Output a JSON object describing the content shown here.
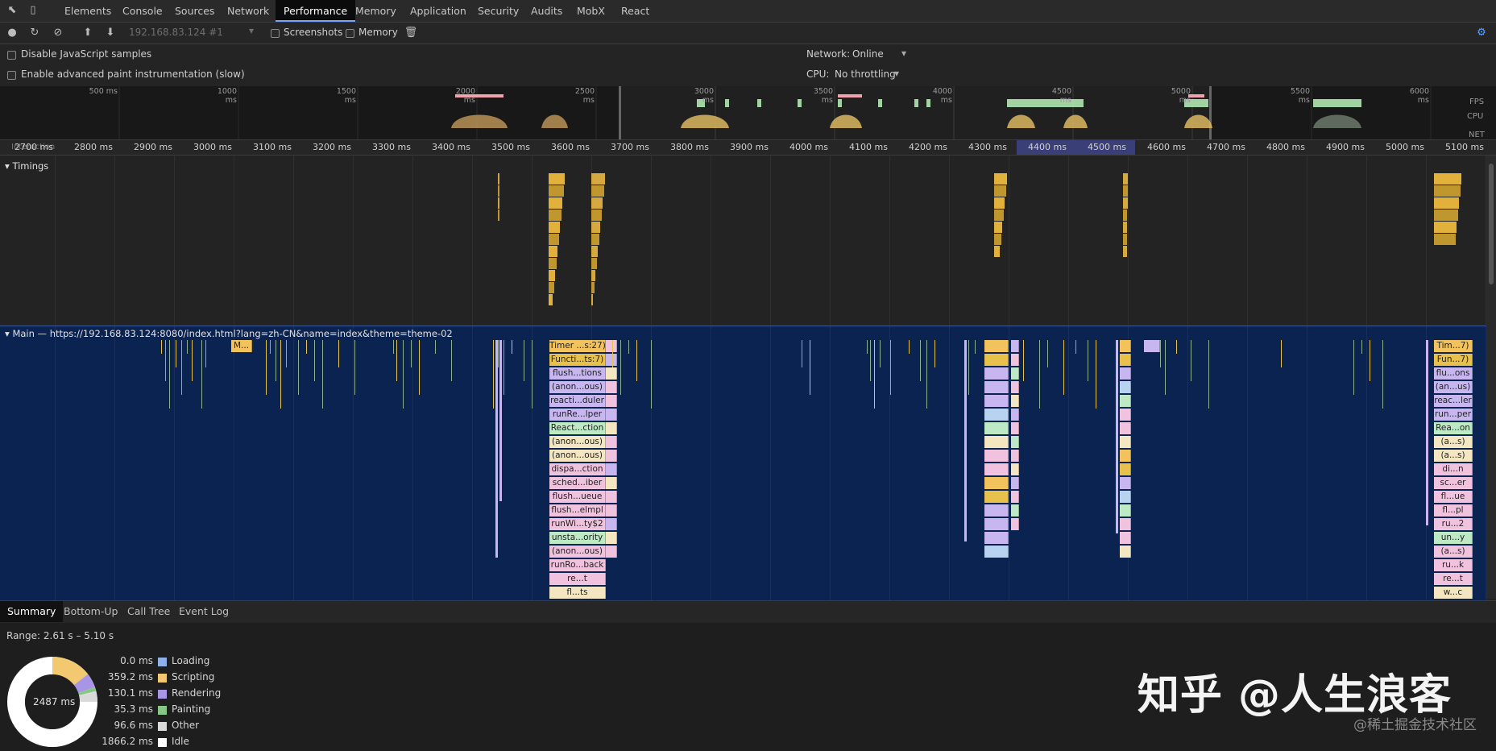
{
  "tabs": [
    "Elements",
    "Console",
    "Sources",
    "Network",
    "Performance",
    "Memory",
    "Application",
    "Security",
    "Audits",
    "MobX",
    "React"
  ],
  "active_tab": "Performance",
  "toolbar": {
    "profile_select": "192.168.83.124 #1",
    "screenshots_label": "Screenshots",
    "memory_label": "Memory"
  },
  "settings": {
    "disable_js_samples": "Disable JavaScript samples",
    "advanced_paint": "Enable advanced paint instrumentation (slow)",
    "network_label": "Network:",
    "network_value": "Online",
    "cpu_label": "CPU:",
    "cpu_value": "No throttling"
  },
  "overview": {
    "ticks": [
      "500 ms",
      "1000 ms",
      "1500 ms",
      "2000 ms",
      "2500 ms",
      "3000 ms",
      "3500 ms",
      "4000 ms",
      "4500 ms",
      "5000 ms",
      "5500 ms",
      "6000 ms"
    ],
    "labels": {
      "fps": "FPS",
      "cpu": "CPU",
      "net": "NET"
    }
  },
  "ruler": {
    "ticks": [
      "2700 ms",
      "2800 ms",
      "2900 ms",
      "3000 ms",
      "3100 ms",
      "3200 ms",
      "3300 ms",
      "3400 ms",
      "3500 ms",
      "3600 ms",
      "3700 ms",
      "3800 ms",
      "3900 ms",
      "4000 ms",
      "4100 ms",
      "4200 ms",
      "4300 ms",
      "4400 ms",
      "4500 ms",
      "4600 ms",
      "4700 ms",
      "4800 ms",
      "4900 ms",
      "5000 ms",
      "5100 ms"
    ],
    "hidden_label": "Interaction"
  },
  "timings_label": "Timings",
  "main_label": "Main — https://192.168.83.124:8080/index.html?lang=zh-CN&name=index&theme=theme-02",
  "flame": {
    "colors": {
      "timer": "#f2c25c",
      "yellow": "#e8c04c",
      "lav": "#c7b6ef",
      "pink": "#f0c2dd",
      "mint": "#bde9c4",
      "blue": "#b7d3ef",
      "cream": "#f3e6c0",
      "peach": "#f6d0b8",
      "gray": "#d8d8d8"
    },
    "cluster1": [
      "Timer ...s:27)",
      "Functi...ts:7)",
      "flush...tions",
      "(anon...ous)",
      "reacti...duler",
      "runRe...lper",
      "React...ction",
      "(anon...ous)",
      "(anon...ous)",
      "dispa...ction",
      "sched...iber",
      "flush...ueue",
      "flush...elmpl",
      "runWi...ty$2",
      "unsta...ority",
      "(anon...ous)",
      "runRo...back",
      "re...t",
      "fl...ts"
    ],
    "cluster4": [
      "Tim...7)",
      "Fun...7)",
      "flu...ons",
      "(an...us)",
      "reac...ler",
      "run...per",
      "Rea...on",
      "(a...s)",
      "(a...s)",
      "di...n",
      "sc...er",
      "fl...ue",
      "fl...pl",
      "ru...2",
      "un...y",
      "(a...s)",
      "ru...k",
      "re...t",
      "w...c"
    ],
    "small_label": "M..."
  },
  "bottom_tabs": [
    "Summary",
    "Bottom-Up",
    "Call Tree",
    "Event Log"
  ],
  "active_bottom_tab": "Summary",
  "summary": {
    "range": "Range: 2.61 s – 5.10 s",
    "total": "2487 ms",
    "rows": [
      {
        "value": "0.0 ms",
        "name": "Loading",
        "color": "#8fb1e8"
      },
      {
        "value": "359.2 ms",
        "name": "Scripting",
        "color": "#f2c870"
      },
      {
        "value": "130.1 ms",
        "name": "Rendering",
        "color": "#a995e6"
      },
      {
        "value": "35.3 ms",
        "name": "Painting",
        "color": "#87c785"
      },
      {
        "value": "96.6 ms",
        "name": "Other",
        "color": "#dadada"
      },
      {
        "value": "1866.2 ms",
        "name": "Idle",
        "color": "#ffffff"
      }
    ]
  },
  "watermark": "知乎 @人生浪客",
  "watermark2": "@稀土掘金技术社区"
}
